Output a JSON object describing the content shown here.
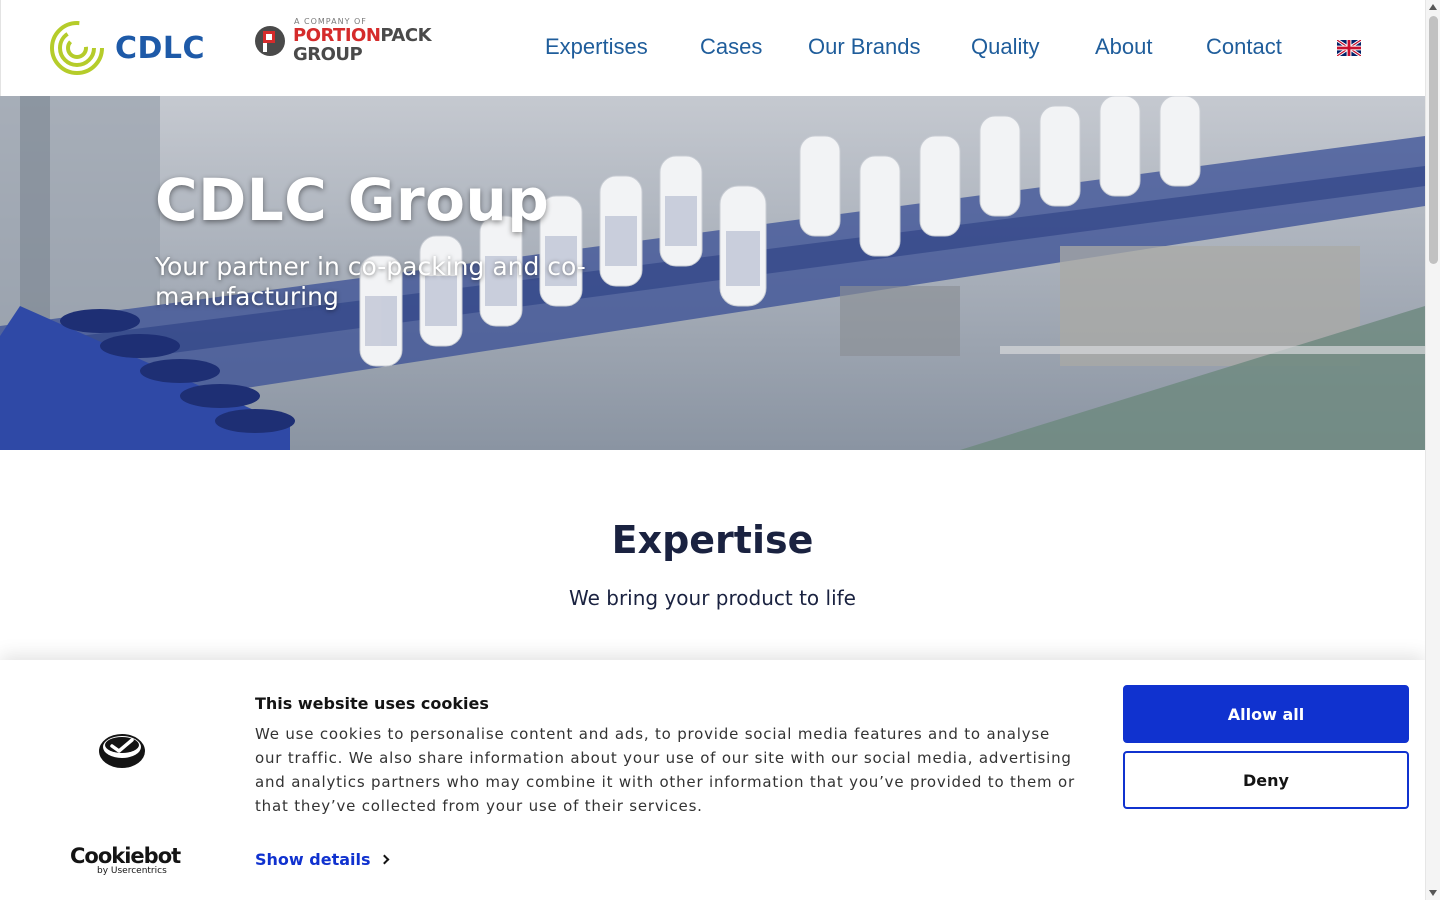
{
  "header": {
    "logo_text": "CDLC",
    "partner_logo": {
      "tagline": "A COMPANY OF",
      "name_part1": "PORTION",
      "name_part2": "PACK",
      "name_part3": "GROUP"
    },
    "nav": [
      {
        "label": "Expertises"
      },
      {
        "label": "Cases"
      },
      {
        "label": "Our Brands"
      },
      {
        "label": "Quality"
      },
      {
        "label": "About"
      },
      {
        "label": "Contact"
      }
    ],
    "language_icon": "uk-flag-icon"
  },
  "hero": {
    "title": "CDLC Group",
    "subtitle": "Your partner in co-packing and co-manufacturing"
  },
  "expertise": {
    "title": "Expertise",
    "subtitle": "We bring your product to life"
  },
  "cookie_banner": {
    "title": "This website uses cookies",
    "text": "We use cookies to personalise content and ads, to provide social media features and to analyse our traffic. We also share information about your use of our site with our social media, advertising and analytics partners who may combine it with other information that you’ve provided to them or that they’ve collected from your use of their services.",
    "show_details": "Show details",
    "allow_all": "Allow all",
    "deny": "Deny",
    "brand": "Cookiebot",
    "brand_sub": "by Usercentrics"
  },
  "colors": {
    "nav_text": "#1f5d9b",
    "brand_blue": "#1e5aa8",
    "brand_green": "#b5cc2a",
    "cookie_primary": "#1032cf"
  }
}
